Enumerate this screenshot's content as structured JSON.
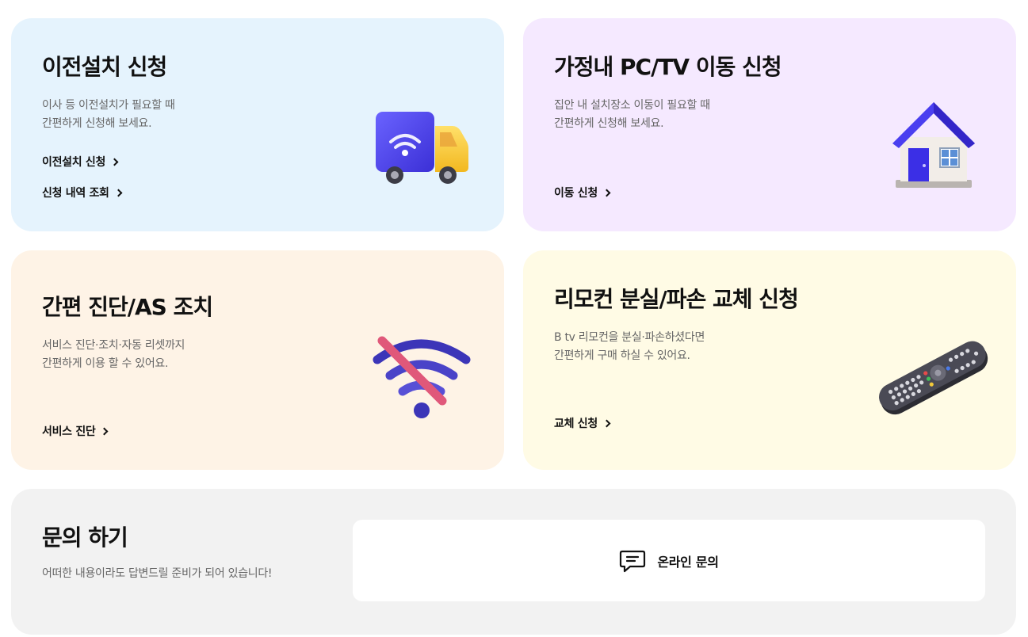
{
  "colors": {
    "card1_bg": "#e5f3fd",
    "card2_bg": "#f5e9ff",
    "card3_bg": "#fef3e6",
    "card4_bg": "#fffbe5",
    "card5_bg": "#f2f2f2"
  },
  "cards": [
    {
      "title": "이전설치 신청",
      "desc": [
        "이사 등 이전설치가 필요할 때",
        "간편하게 신청해 보세요."
      ],
      "links": [
        "이전설치 신청",
        "신청 내역 조회"
      ],
      "icon": "truck-wifi-icon"
    },
    {
      "title": "가정내 PC/TV 이동 신청",
      "desc": [
        "집안 내 설치장소 이동이 필요할 때",
        "간편하게 신청해 보세요."
      ],
      "links": [
        "이동 신청"
      ],
      "icon": "house-icon"
    },
    {
      "title": "간편 진단/AS 조치",
      "desc": [
        "서비스 진단·조치·자동 리셋까지",
        "간편하게 이용 할 수 있어요."
      ],
      "links": [
        "서비스 진단"
      ],
      "icon": "wifi-off-icon"
    },
    {
      "title": "리모컨 분실/파손 교체 신청",
      "desc": [
        "B tv 리모컨을 분실·파손하셨다면",
        "간편하게 구매 하실 수 있어요."
      ],
      "links": [
        "교체 신청"
      ],
      "icon": "remote-control-icon"
    }
  ],
  "inquiry": {
    "title": "문의 하기",
    "desc": "어떠한 내용이라도 답변드릴 준비가 되어 있습니다!",
    "button_label": "온라인 문의",
    "icon": "chat-icon"
  }
}
